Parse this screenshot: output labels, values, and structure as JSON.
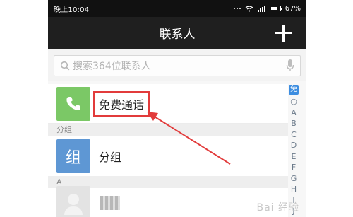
{
  "status_bar": {
    "time": "晚上10:04",
    "battery": "67%",
    "battery_level": 0.67
  },
  "header": {
    "title": "联系人",
    "add_icon": "plus-icon"
  },
  "search": {
    "placeholder": "搜索364位联系人",
    "search_icon": "search-icon",
    "mic_icon": "microphone-icon"
  },
  "list": {
    "free_call": {
      "label": "免费通话",
      "icon": "phone-icon"
    },
    "section_group": "分组",
    "group": {
      "avatar_text": "组",
      "label": "分组"
    },
    "section_a": "A"
  },
  "index_bar": {
    "free": "免",
    "letters": [
      "○",
      "A",
      "B",
      "C",
      "D",
      "E",
      "F",
      "G",
      "H",
      "I",
      "J"
    ]
  },
  "watermark": "Bai 经验",
  "colors": {
    "annotation": "#e23b3b",
    "free_call_avatar": "#7bc866",
    "group_avatar": "#5e97d4",
    "index_highlight": "#3d8de0"
  }
}
